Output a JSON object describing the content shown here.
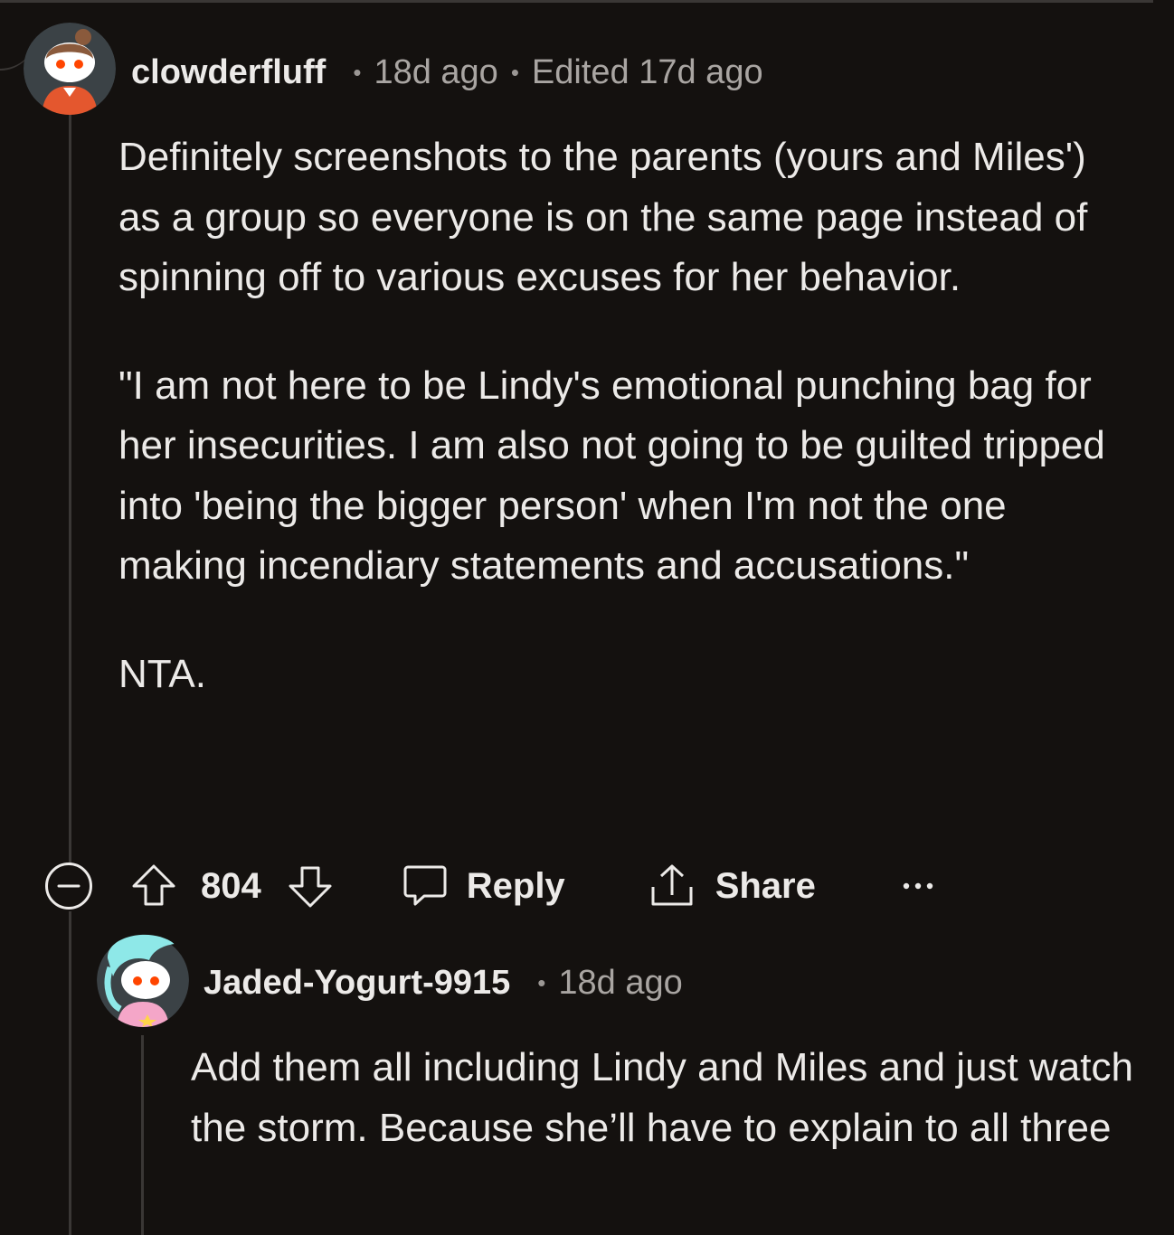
{
  "colors": {
    "background": "#14110f",
    "text": "#eceae8",
    "meta_text": "#a9a5a2",
    "thread_line": "#3a3735"
  },
  "comment": {
    "username": "clowderfluff",
    "time": "18d ago",
    "edited": "Edited 17d ago",
    "paragraphs": [
      "Definitely screenshots to the parents (yours and Miles') as a group so everyone is on the same page instead of spinning off to various excuses for her behavior.",
      "\"I am not here to be Lindy's emotional punching bag for her insecurities. I am also not going to be guilted tripped into 'being the bigger person' when I'm not the one making incendiary statements and accusations.\"",
      "NTA."
    ],
    "actions": {
      "collapse_icon": "minus-circle-icon",
      "upvote_icon": "arrow-up-icon",
      "score": "804",
      "downvote_icon": "arrow-down-icon",
      "reply_icon": "speech-bubble-icon",
      "reply_label": "Reply",
      "share_icon": "share-icon",
      "share_label": "Share",
      "more_icon": "more-horizontal-icon"
    }
  },
  "reply": {
    "username": "Jaded-Yogurt-9915",
    "time": "18d ago",
    "text": "Add them all including Lindy and Miles and just watch the storm. Because she’ll have to explain to all three"
  }
}
